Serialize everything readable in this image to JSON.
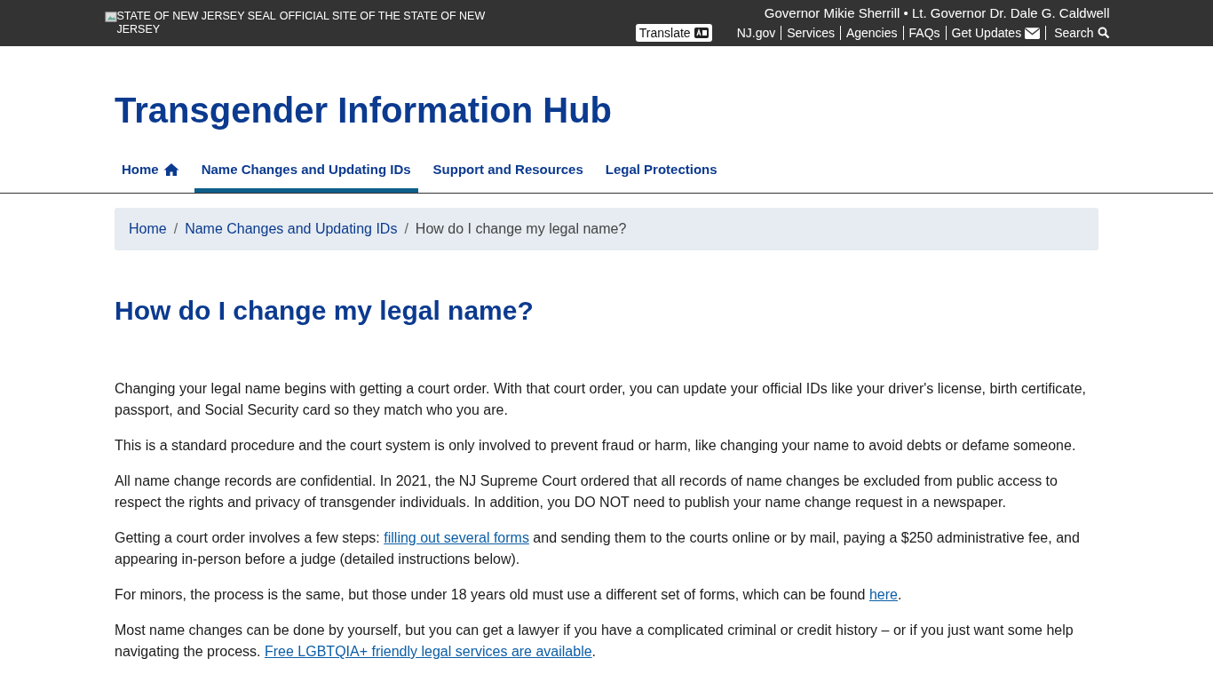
{
  "top_bar": {
    "seal_alt": "STATE OF NEW JERSEY SEAL",
    "official_site": "OFFICIAL SITE OF THE STATE OF NEW JERSEY",
    "governor_line": "Governor Mikie Sherrill • Lt. Governor Dr. Dale G. Caldwell",
    "translate": "Translate",
    "links": [
      {
        "label": "NJ.gov",
        "kind": "plain"
      },
      {
        "label": "Services",
        "kind": "plain"
      },
      {
        "label": "Agencies",
        "kind": "plain"
      },
      {
        "label": "FAQs",
        "kind": "plain"
      },
      {
        "label": "Get Updates",
        "kind": "mail"
      },
      {
        "label": "Search",
        "kind": "search"
      }
    ]
  },
  "site_title": "Transgender Information Hub",
  "nav": [
    {
      "label": "Home",
      "kind": "home",
      "selected": false
    },
    {
      "label": "Name Changes and Updating IDs",
      "kind": "plain",
      "selected": true
    },
    {
      "label": "Support and Resources",
      "kind": "plain",
      "selected": false
    },
    {
      "label": "Legal Protections",
      "kind": "plain",
      "selected": false
    }
  ],
  "breadcrumb_separator": "/",
  "breadcrumb": [
    {
      "label": "Home",
      "current": false
    },
    {
      "label": "Name Changes and Updating IDs",
      "current": false
    },
    {
      "label": "How do I change my legal name?",
      "current": true
    }
  ],
  "page_title": "How do I change my legal name?",
  "paragraphs": [
    [
      {
        "kind": "text",
        "text": "Changing your legal name begins with getting a court order. With that court order, you can update your official IDs like your driver's license, birth certificate, passport, and Social Security card so they match who you are."
      }
    ],
    [
      {
        "kind": "text",
        "text": "This is a standard procedure and the court system is only involved to prevent fraud or harm, like changing your name to avoid debts or defame someone."
      }
    ],
    [
      {
        "kind": "text",
        "text": "All name change records are confidential. In 2021, the NJ Supreme Court ordered that all records of name changes be excluded from public access to respect the rights and privacy of transgender individuals. In addition, you DO NOT need to publish your name change request in a newspaper."
      }
    ],
    [
      {
        "kind": "text",
        "text": "Getting a court order involves a few steps: "
      },
      {
        "kind": "link",
        "text": "filling out several forms"
      },
      {
        "kind": "text",
        "text": " and sending them to the courts online or by mail, paying a $250 administrative fee, and appearing in-person before a judge (detailed instructions below)."
      }
    ],
    [
      {
        "kind": "text",
        "text": "For minors, the process is the same, but those under 18 years old must use a different set of forms, which can be found "
      },
      {
        "kind": "link",
        "text": "here"
      },
      {
        "kind": "text",
        "text": "."
      }
    ],
    [
      {
        "kind": "text",
        "text": "Most name changes can be done by yourself, but you can get a lawyer if you have a complicated criminal or credit history – or if you just want some help navigating the process. "
      },
      {
        "kind": "link",
        "text": "Free LGBTQIA+ friendly legal services are available"
      },
      {
        "kind": "text",
        "text": "."
      }
    ]
  ]
}
